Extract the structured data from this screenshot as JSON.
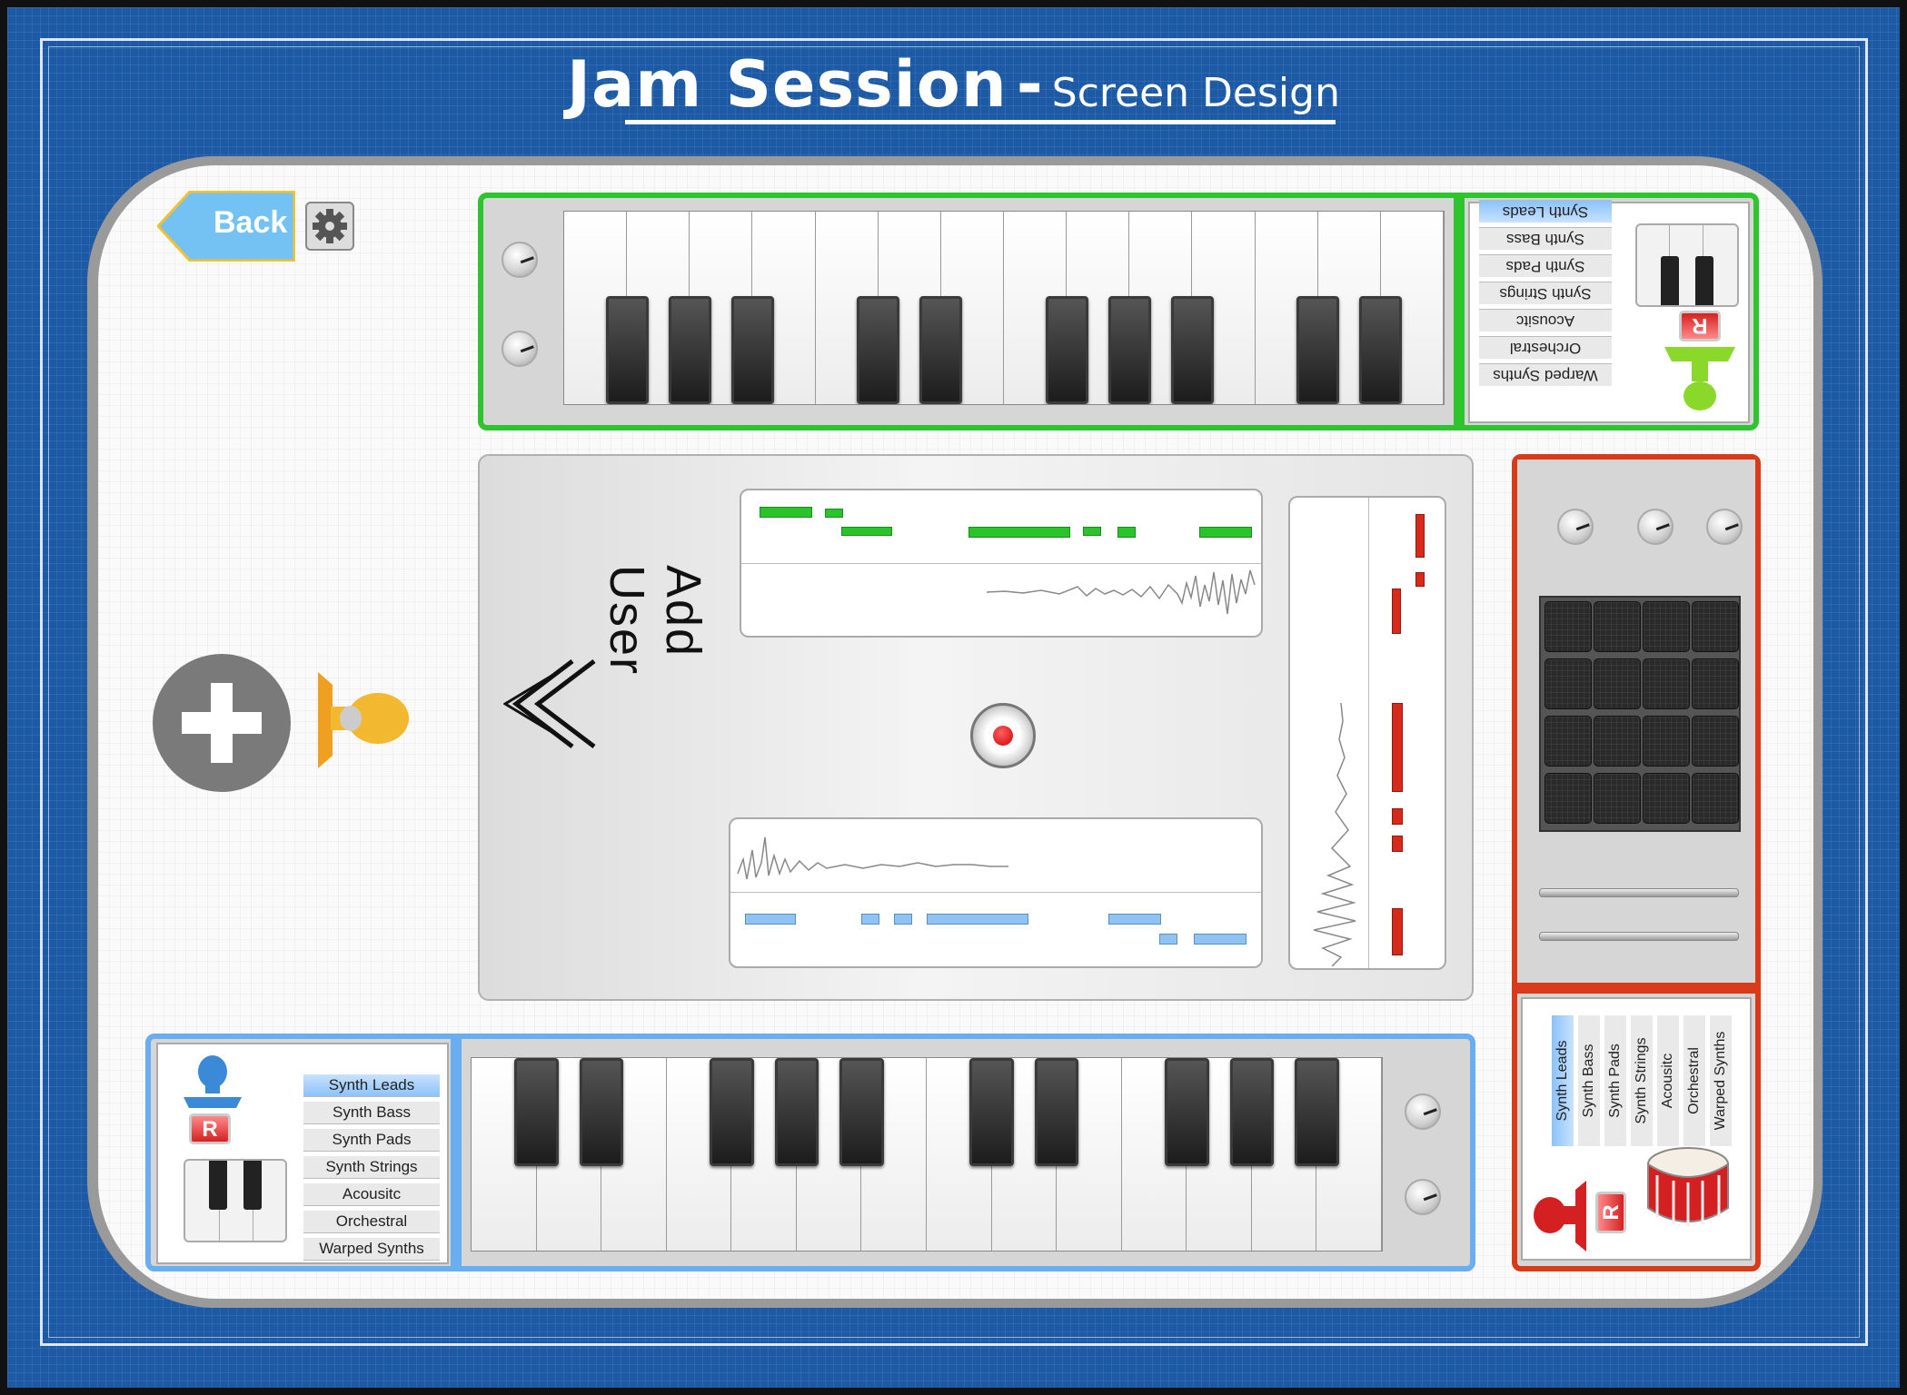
{
  "page": {
    "title": "Jam Session",
    "title_separator": "-",
    "subtitle": "Screen Design"
  },
  "nav": {
    "back_label": "Back",
    "settings_icon": "gear-icon"
  },
  "center": {
    "add_user_label": "Add User",
    "chevron_icon": "double-chevron-left-icon",
    "record_icon": "record-icon",
    "add_icon": "plus-icon",
    "stamp_icon": "user-stamp-icon"
  },
  "presets_green": [
    "Warped Synths",
    "Orchestral",
    "Acousitc",
    "Synth Strings",
    "Synth Pads",
    "Synth Bass",
    "Synth Leads"
  ],
  "presets_blue": [
    "Synth Leads",
    "Synth Bass",
    "Synth Pads",
    "Synth Strings",
    "Acousitc",
    "Orchestral",
    "Warped Synths"
  ],
  "presets_red": [
    "Synth Leads",
    "Synth Bass",
    "Synth Pads",
    "Synth Strings",
    "Acousitc",
    "Orchestral",
    "Warped Synths"
  ],
  "record_button_label": "R",
  "colors": {
    "blueprint": "#1d5aa6",
    "green_player": "#2ec42e",
    "blue_player": "#6aaef2",
    "red_player": "#d83a1a",
    "selected_preset": "#8cc2fa"
  },
  "selected_preset": "Synth Leads"
}
